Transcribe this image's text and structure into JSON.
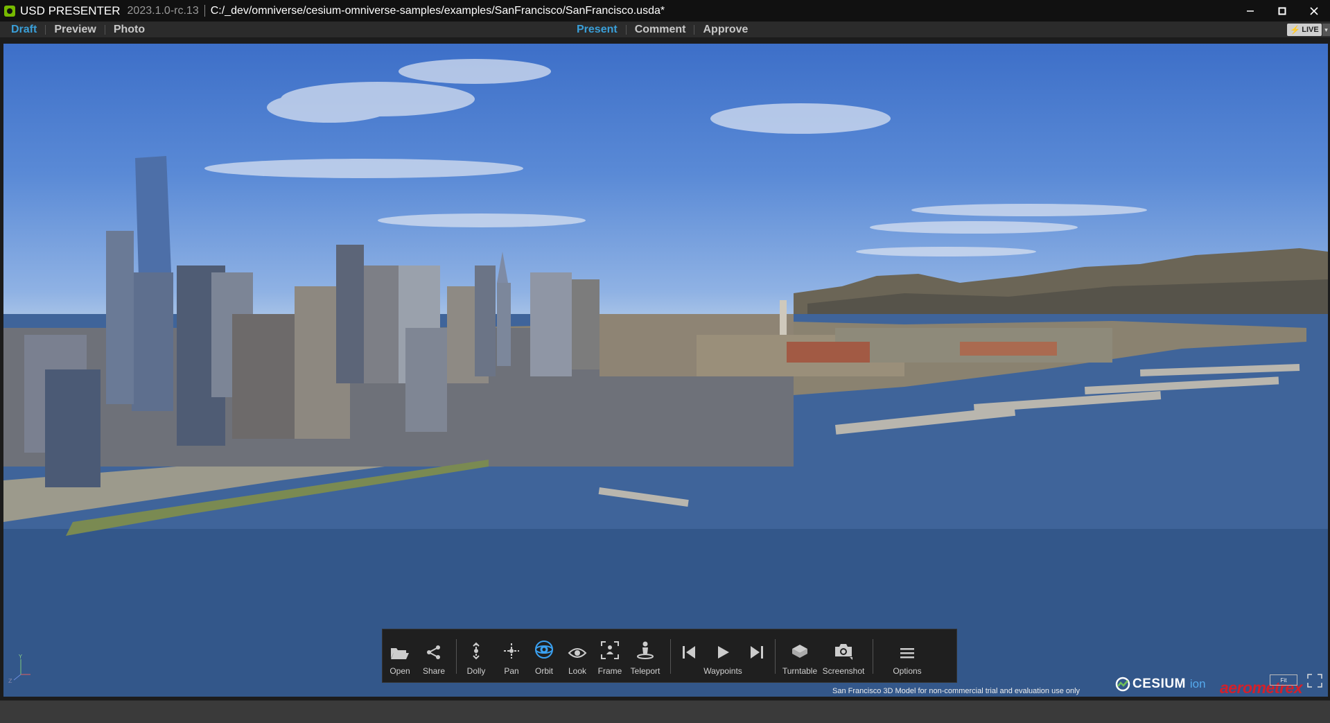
{
  "window": {
    "app_name": "USD PRESENTER",
    "version": "2023.1.0-rc.13",
    "file_path": "C:/_dev/omniverse/cesium-omniverse-samples/examples/SanFrancisco/SanFrancisco.usda*",
    "controls": [
      "minimize-icon",
      "maximize-icon",
      "close-icon"
    ]
  },
  "modes": {
    "left": [
      {
        "label": "Draft",
        "active": true
      },
      {
        "label": "Preview",
        "active": false
      },
      {
        "label": "Photo",
        "active": false
      }
    ],
    "center": [
      {
        "label": "Present",
        "active": true
      },
      {
        "label": "Comment",
        "active": false
      },
      {
        "label": "Approve",
        "active": false
      }
    ],
    "live_label": "LIVE"
  },
  "toolbar": {
    "open": "Open",
    "share": "Share",
    "dolly": "Dolly",
    "pan": "Pan",
    "orbit": "Orbit",
    "look": "Look",
    "frame": "Frame",
    "teleport": "Teleport",
    "waypoints": "Waypoints",
    "turntable": "Turntable",
    "screenshot": "Screenshot",
    "options": "Options",
    "active_tool": "Orbit",
    "accent_color": "#3aa0f0"
  },
  "viewport": {
    "disclaimer": "San Francisco 3D Model for non-commercial trial and evaluation use only",
    "logo_cesium": "CESIUM",
    "logo_ion": "ion",
    "logo_aerometrex": "aerometrex",
    "fit_label": "Fit"
  }
}
